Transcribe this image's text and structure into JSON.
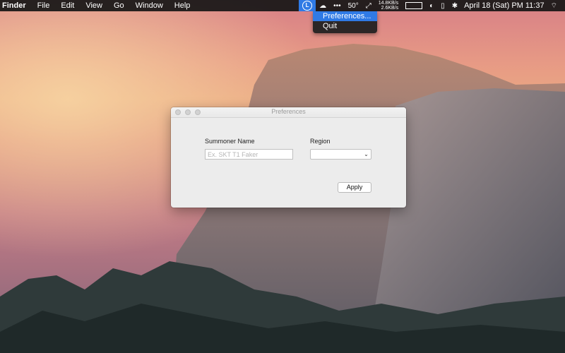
{
  "menubar": {
    "app": "Finder",
    "menus": [
      "File",
      "Edit",
      "View",
      "Go",
      "Window",
      "Help"
    ],
    "status": {
      "lol_icon": "L",
      "dots": "•••",
      "temperature": "50°",
      "net_up": "14.8KB/s",
      "net_down": "2.6KB/s",
      "datetime": "April 18 (Sat) PM 11:37"
    }
  },
  "status_menu": {
    "items": [
      "Preferences...",
      "Quit"
    ]
  },
  "window": {
    "title": "Preferences",
    "summoner_label": "Summoner Name",
    "summoner_placeholder": "Ex. SKT T1 Faker",
    "summoner_value": "",
    "region_label": "Region",
    "region_value": "",
    "apply_label": "Apply"
  },
  "colors": {
    "menu_highlight": "#2f7ae5",
    "window_bg": "#ececec"
  }
}
